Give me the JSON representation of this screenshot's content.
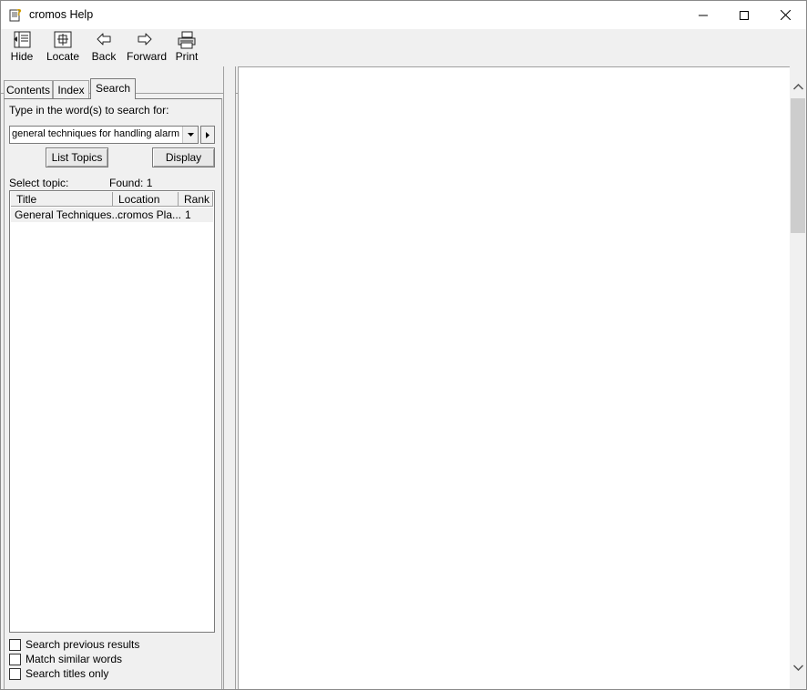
{
  "window": {
    "title": "cromos Help",
    "icon": "help-book-question-icon"
  },
  "caption_buttons": {
    "minimize": "minimize-icon",
    "maximize": "maximize-icon",
    "close": "close-icon"
  },
  "toolbar": {
    "hide": "Hide",
    "locate": "Locate",
    "back": "Back",
    "forward": "Forward",
    "print": "Print"
  },
  "tabs": {
    "contents": "Contents",
    "index": "Index",
    "search": "Search",
    "active": "Search"
  },
  "search": {
    "prompt": "Type in the word(s) to search for:",
    "query": "general techniques for handling alarms",
    "list_topics_button": "List Topics",
    "display_button": "Display",
    "select_topic_label": "Select topic:",
    "found_label": "Found: 1"
  },
  "results": {
    "columns": {
      "title": "Title",
      "location": "Location",
      "rank": "Rank"
    },
    "rows": [
      {
        "title": "General Techniques...",
        "location": "cromos Pla...",
        "rank": "1"
      }
    ]
  },
  "options": {
    "search_previous": {
      "label": "Search previous results",
      "checked": false
    },
    "match_similar": {
      "label": "Match similar words",
      "checked": false
    },
    "titles_only": {
      "label": "Search titles only",
      "checked": false
    }
  },
  "colors": {
    "background": "#f0f0f0",
    "content": "#ffffff",
    "border": "#a0a0a0"
  }
}
